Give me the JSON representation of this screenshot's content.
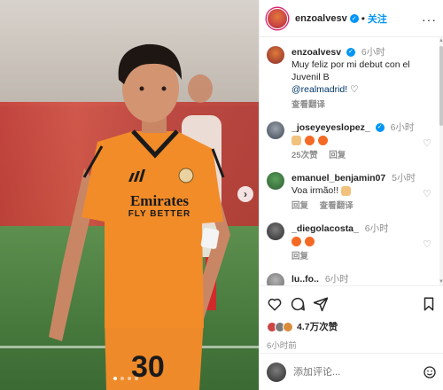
{
  "post": {
    "username": "enzoalvesv",
    "follow_label": "关注",
    "dot": "•",
    "more": "···"
  },
  "caption": {
    "username": "enzoalvesv",
    "time": "6小时",
    "text": "Muy feliz por mi debut con el Juvenil B",
    "mention": "@realmadrid!",
    "translate": "查看翻译"
  },
  "comments": [
    {
      "username": "_joseyeyeslopez_",
      "verified": true,
      "time": "6小时",
      "text": "",
      "likes": "25次赞",
      "reply": "回复",
      "translate": ""
    },
    {
      "username": "emanuel_benjamin07",
      "verified": false,
      "time": "5小时",
      "text": "Voa irmão!!",
      "likes": "",
      "reply": "回复",
      "translate": "查看翻译"
    },
    {
      "username": "_diegolacosta_",
      "verified": false,
      "time": "6小时",
      "text": "",
      "likes": "",
      "reply": "回复",
      "translate": ""
    }
  ],
  "partial_comment": {
    "username": "lu..fo..",
    "time": "6小时"
  },
  "engagement": {
    "likes": "4.7万次赞",
    "time": "6小时前"
  },
  "add_comment": {
    "placeholder": "添加评论..."
  },
  "photo": {
    "jersey_sponsor_1": "Emirates",
    "jersey_sponsor_2": "FLY BETTER",
    "number": "30",
    "next_glyph": "›"
  },
  "colors": {
    "accent": "#0095f6",
    "jersey": "#f28c28",
    "link": "#00376b"
  }
}
